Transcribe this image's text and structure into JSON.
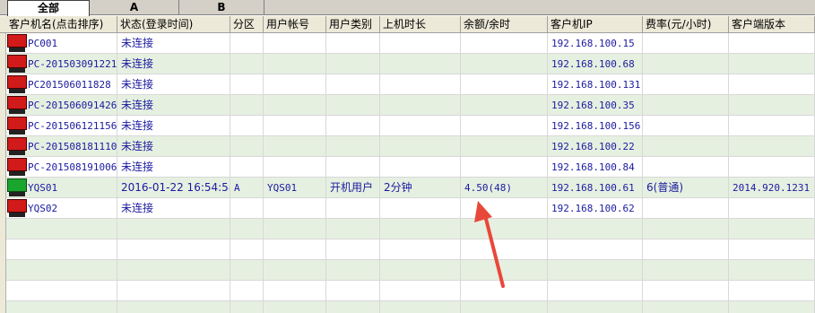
{
  "tabs": [
    {
      "label": "全部",
      "active": true
    },
    {
      "label": "A",
      "active": false
    },
    {
      "label": "B",
      "active": false
    }
  ],
  "columns": [
    "客户机名(点击排序)",
    "状态(登录时间)",
    "分区",
    "用户帐号",
    "用户类别",
    "上机时长",
    "余额/余时",
    "客户机IP",
    "费率(元/小时)",
    "客户端版本"
  ],
  "rows": [
    {
      "name": "PC001",
      "status": "未连接",
      "partition": "",
      "account": "",
      "user_type": "",
      "duration": "",
      "balance": "",
      "ip": "192.168.100.15",
      "rate": "",
      "version": "",
      "icon": "red"
    },
    {
      "name": "PC-201503091221",
      "status": "未连接",
      "partition": "",
      "account": "",
      "user_type": "",
      "duration": "",
      "balance": "",
      "ip": "192.168.100.68",
      "rate": "",
      "version": "",
      "icon": "red"
    },
    {
      "name": "PC201506011828",
      "status": "未连接",
      "partition": "",
      "account": "",
      "user_type": "",
      "duration": "",
      "balance": "",
      "ip": "192.168.100.131",
      "rate": "",
      "version": "",
      "icon": "red"
    },
    {
      "name": "PC-201506091426",
      "status": "未连接",
      "partition": "",
      "account": "",
      "user_type": "",
      "duration": "",
      "balance": "",
      "ip": "192.168.100.35",
      "rate": "",
      "version": "",
      "icon": "red"
    },
    {
      "name": "PC-201506121156",
      "status": "未连接",
      "partition": "",
      "account": "",
      "user_type": "",
      "duration": "",
      "balance": "",
      "ip": "192.168.100.156",
      "rate": "",
      "version": "",
      "icon": "red"
    },
    {
      "name": "PC-201508181110",
      "status": "未连接",
      "partition": "",
      "account": "",
      "user_type": "",
      "duration": "",
      "balance": "",
      "ip": "192.168.100.22",
      "rate": "",
      "version": "",
      "icon": "red"
    },
    {
      "name": "PC-201508191006",
      "status": "未连接",
      "partition": "",
      "account": "",
      "user_type": "",
      "duration": "",
      "balance": "",
      "ip": "192.168.100.84",
      "rate": "",
      "version": "",
      "icon": "red"
    },
    {
      "name": "YQS01",
      "status": "2016-01-22 16:54:58",
      "partition": "A",
      "account": "YQS01",
      "user_type": "开机用户",
      "duration": "2分钟",
      "balance": "4.50(48)",
      "ip": "192.168.100.61",
      "rate": "6(普通)",
      "version": "2014.920.1231",
      "icon": "green"
    },
    {
      "name": "YQS02",
      "status": "未连接",
      "partition": "",
      "account": "",
      "user_type": "",
      "duration": "",
      "balance": "",
      "ip": "192.168.100.62",
      "rate": "",
      "version": "",
      "icon": "red"
    }
  ],
  "empty_rows": 5,
  "colors": {
    "row_alt": "#e6f0e1",
    "text": "#1a1aa0",
    "arrow": "#e8483a"
  }
}
